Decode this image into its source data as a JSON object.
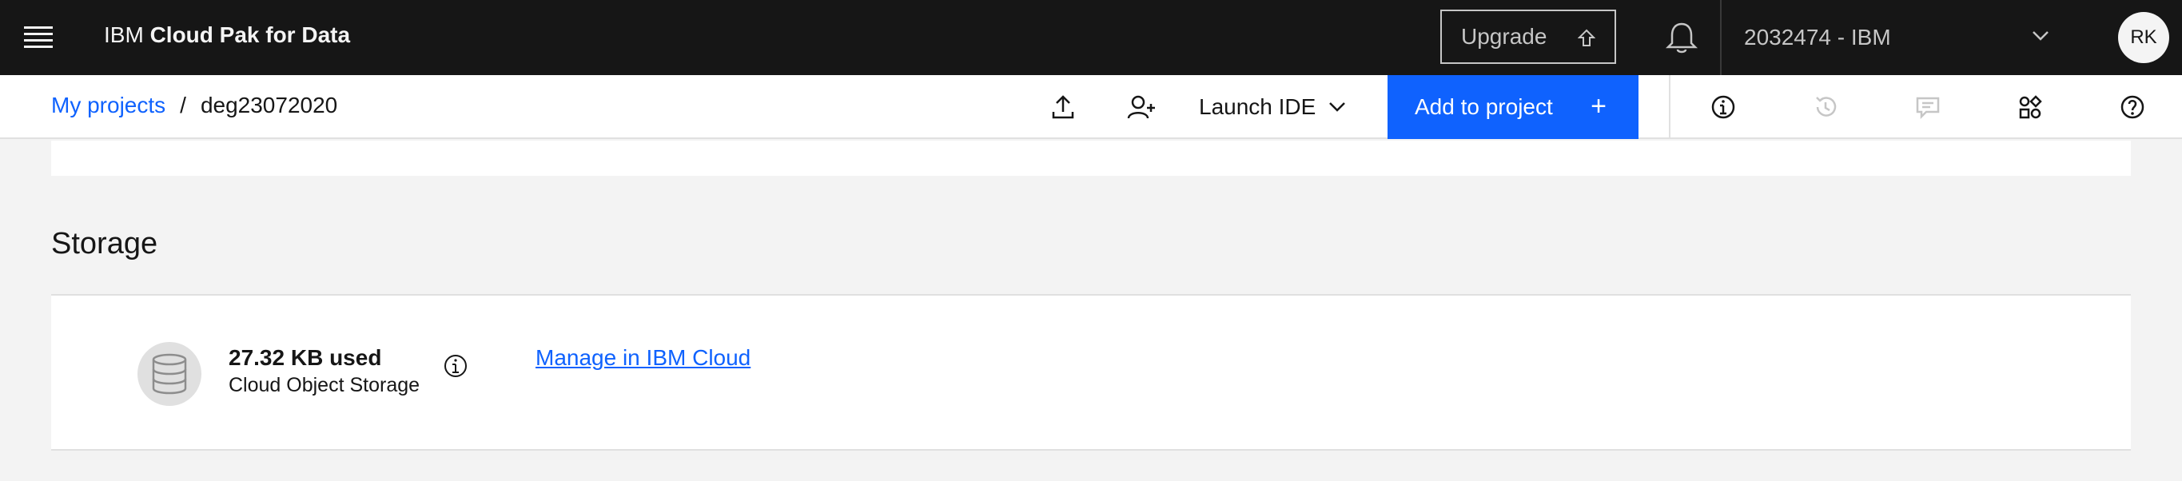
{
  "header": {
    "brand_prefix": "IBM",
    "brand_product": "Cloud Pak for Data",
    "upgrade_label": "Upgrade",
    "account_label": "2032474 - IBM",
    "avatar_initials": "RK"
  },
  "breadcrumb": {
    "parent": "My projects",
    "separator": "/",
    "current": "deg23072020"
  },
  "toolbar": {
    "launch_ide_label": "Launch IDE",
    "add_to_project_label": "Add to project",
    "add_icon": "+"
  },
  "storage": {
    "title": "Storage",
    "used": "27.32 KB used",
    "type": "Cloud Object Storage",
    "manage_link": "Manage in IBM Cloud"
  },
  "colors": {
    "primary": "#0f62fe",
    "header_bg": "#161616",
    "page_bg": "#f3f3f3"
  }
}
